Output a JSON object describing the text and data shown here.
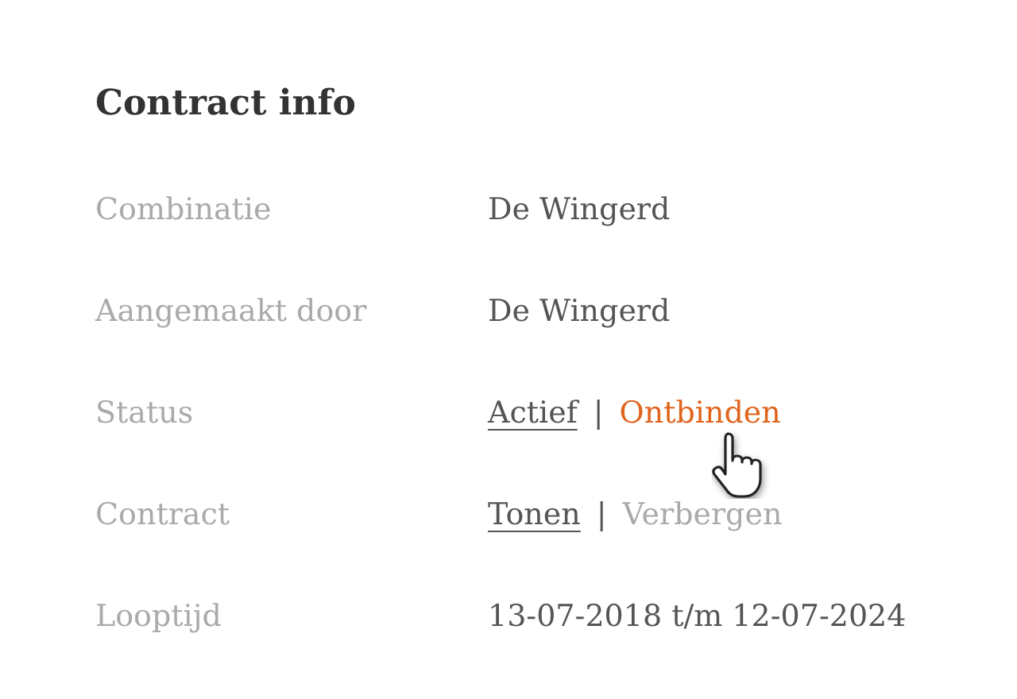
{
  "title": "Contract info",
  "rows": [
    {
      "label": "Combinatie",
      "kind": "text",
      "value": "De Wingerd"
    },
    {
      "label": "Aangemaakt door",
      "kind": "text",
      "value": "De Wingerd"
    },
    {
      "label": "Status",
      "kind": "options",
      "separator": "|",
      "options": [
        {
          "text": "Actief",
          "kind": "option",
          "selected": true
        },
        {
          "text": "Ontbinden",
          "kind": "action",
          "selected": false
        }
      ]
    },
    {
      "label": "Contract",
      "kind": "options",
      "separator": "|",
      "options": [
        {
          "text": "Tonen",
          "kind": "option",
          "selected": true
        },
        {
          "text": "Verbergen",
          "kind": "option",
          "selected": false
        }
      ]
    },
    {
      "label": "Looptijd",
      "kind": "text",
      "value": "13-07-2018 t/m 12-07-2024"
    }
  ]
}
